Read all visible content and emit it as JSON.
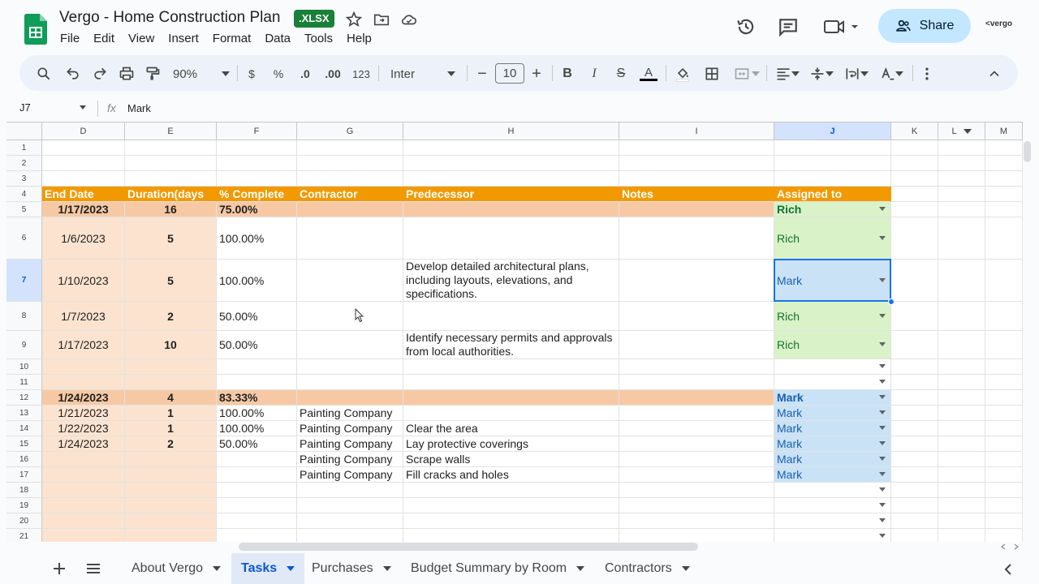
{
  "app": {
    "title": "Vergo - Home Construction Plan",
    "badge": ".XLSX",
    "share_label": "Share",
    "brand": "vergo",
    "menu": [
      "File",
      "Edit",
      "View",
      "Insert",
      "Format",
      "Data",
      "Tools",
      "Help"
    ]
  },
  "toolbar": {
    "zoom": "90%",
    "currency": "$",
    "percent": "%",
    "dec_decrease": ".0",
    "dec_increase": ".00",
    "number_format": "123",
    "font": "Inter",
    "font_size": "10"
  },
  "formula_bar": {
    "cell_ref": "J7",
    "fx": "fx",
    "value": "Mark"
  },
  "columns": [
    "D",
    "E",
    "F",
    "G",
    "H",
    "I",
    "J",
    "K",
    "L",
    "M"
  ],
  "rows": [
    "1",
    "2",
    "3",
    "4",
    "5",
    "6",
    "7",
    "8",
    "9",
    "10",
    "11",
    "12",
    "13",
    "14",
    "15",
    "16",
    "17",
    "18",
    "19",
    "20",
    "21"
  ],
  "header": {
    "end_date": "End Date",
    "duration": "Duration(days",
    "complete": "% Complete",
    "contractor": "Contractor",
    "predecessor": "Predecessor",
    "notes": "Notes",
    "assigned": "Assigned to"
  },
  "data_rows": [
    {
      "row": "5",
      "end": "1/17/2023",
      "dur": "16",
      "pct": "75.00%",
      "contractor": "",
      "pred": "",
      "assigned": "Rich"
    },
    {
      "row": "6",
      "end": "1/6/2023",
      "dur": "5",
      "pct": "100.00%",
      "contractor": "",
      "pred": "",
      "assigned": "Rich"
    },
    {
      "row": "7",
      "end": "1/10/2023",
      "dur": "5",
      "pct": "100.00%",
      "contractor": "",
      "pred": "Develop detailed architectural plans, including layouts, elevations, and specifications.",
      "assigned": "Mark"
    },
    {
      "row": "8",
      "end": "1/7/2023",
      "dur": "2",
      "pct": "50.00%",
      "contractor": "",
      "pred": "",
      "assigned": "Rich"
    },
    {
      "row": "9",
      "end": "1/17/2023",
      "dur": "10",
      "pct": "50.00%",
      "contractor": "",
      "pred": "Identify necessary permits and approvals from local authorities.",
      "assigned": "Rich"
    },
    {
      "row": "12",
      "end": "1/24/2023",
      "dur": "4",
      "pct": "83.33%",
      "contractor": "",
      "pred": "",
      "assigned": "Mark"
    },
    {
      "row": "13",
      "end": "1/21/2023",
      "dur": "1",
      "pct": "100.00%",
      "contractor": "Painting Company",
      "pred": "",
      "assigned": "Mark"
    },
    {
      "row": "14",
      "end": "1/22/2023",
      "dur": "1",
      "pct": "100.00%",
      "contractor": "Painting Company",
      "pred": "Clear the area",
      "assigned": "Mark"
    },
    {
      "row": "15",
      "end": "1/24/2023",
      "dur": "2",
      "pct": "50.00%",
      "contractor": "Painting Company",
      "pred": "Lay protective coverings",
      "assigned": "Mark"
    },
    {
      "row": "16",
      "end": "",
      "dur": "",
      "pct": "",
      "contractor": "Painting Company",
      "pred": "Scrape walls",
      "assigned": "Mark"
    },
    {
      "row": "17",
      "end": "",
      "dur": "",
      "pct": "",
      "contractor": "Painting Company",
      "pred": "Fill cracks and holes",
      "assigned": "Mark"
    }
  ],
  "sheets": [
    "About Vergo",
    "Tasks",
    "Purchases",
    "Budget Summary by Room",
    "Contractors"
  ],
  "active_sheet": "Tasks",
  "colors": {
    "accent": "#f29900",
    "selection": "#1a73e8",
    "share": "#c2e7ff"
  }
}
